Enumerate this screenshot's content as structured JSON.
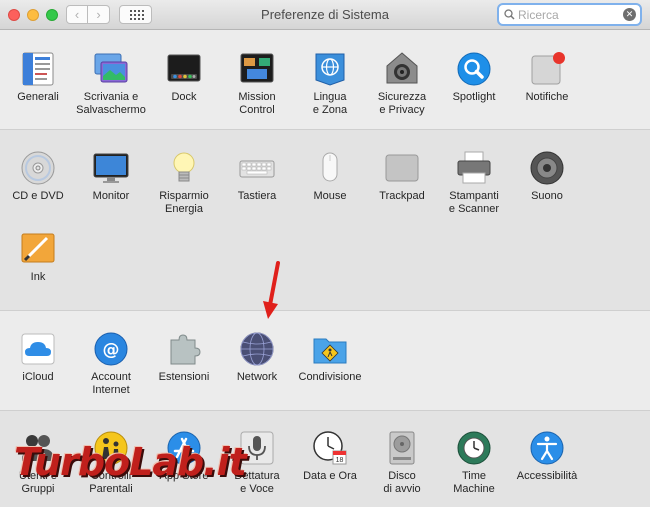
{
  "window": {
    "title": "Preferenze di Sistema",
    "search_placeholder": "Ricerca",
    "search_value": ""
  },
  "nav": {
    "back_glyph": "‹",
    "forward_glyph": "›"
  },
  "sections": [
    {
      "items": [
        {
          "label": "Generali",
          "icon": "generali-icon"
        },
        {
          "label": "Scrivania e\nSalvaschermo",
          "icon": "desktop-screensaver-icon"
        },
        {
          "label": "Dock",
          "icon": "dock-icon"
        },
        {
          "label": "Mission\nControl",
          "icon": "mission-control-icon"
        },
        {
          "label": "Lingua\ne Zona",
          "icon": "language-region-icon"
        },
        {
          "label": "Sicurezza\ne Privacy",
          "icon": "security-privacy-icon"
        },
        {
          "label": "Spotlight",
          "icon": "spotlight-icon"
        },
        {
          "label": "Notifiche",
          "icon": "notifications-icon"
        }
      ]
    },
    {
      "items": [
        {
          "label": "CD e DVD",
          "icon": "cd-dvd-icon"
        },
        {
          "label": "Monitor",
          "icon": "monitor-icon"
        },
        {
          "label": "Risparmio\nEnergia",
          "icon": "energy-saver-icon"
        },
        {
          "label": "Tastiera",
          "icon": "keyboard-icon"
        },
        {
          "label": "Mouse",
          "icon": "mouse-icon"
        },
        {
          "label": "Trackpad",
          "icon": "trackpad-icon"
        },
        {
          "label": "Stampanti\ne Scanner",
          "icon": "printer-scanner-icon"
        },
        {
          "label": "Suono",
          "icon": "sound-icon"
        },
        {
          "label": "Ink",
          "icon": "ink-icon"
        }
      ]
    },
    {
      "items": [
        {
          "label": "iCloud",
          "icon": "icloud-icon"
        },
        {
          "label": "Account\nInternet",
          "icon": "internet-accounts-icon"
        },
        {
          "label": "Estensioni",
          "icon": "extensions-icon"
        },
        {
          "label": "Network",
          "icon": "network-icon"
        },
        {
          "label": "Condivisione",
          "icon": "sharing-icon"
        }
      ]
    },
    {
      "items": [
        {
          "label": "Utenti e\nGruppi",
          "icon": "users-groups-icon"
        },
        {
          "label": "Controlli\nParentali",
          "icon": "parental-controls-icon"
        },
        {
          "label": "App Store",
          "icon": "app-store-icon"
        },
        {
          "label": "Dettatura\ne Voce",
          "icon": "dictation-speech-icon"
        },
        {
          "label": "Data e Ora",
          "icon": "date-time-icon"
        },
        {
          "label": "Disco\ndi avvio",
          "icon": "startup-disk-icon"
        },
        {
          "label": "Time\nMachine",
          "icon": "time-machine-icon"
        },
        {
          "label": "Accessibilità",
          "icon": "accessibility-icon"
        }
      ]
    }
  ],
  "watermark": {
    "text": "TurboLab.it"
  },
  "colors": {
    "search_focus": "#7fb1ec",
    "arrow": "#e0201b",
    "watermark": "#c0201c"
  }
}
